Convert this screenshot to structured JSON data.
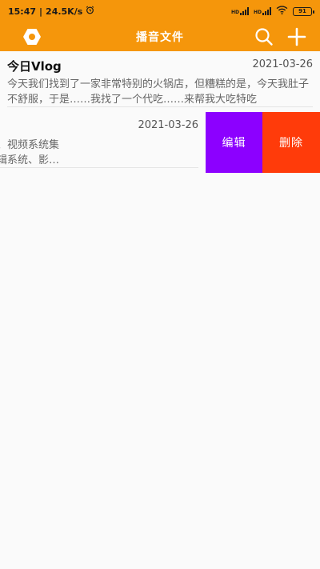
{
  "status_bar": {
    "time": "15:47",
    "network_speed": "24.5K/s",
    "alarm_icon": "alarm-clock-icon",
    "hd1": "HD",
    "hd2": "HD",
    "battery": "91"
  },
  "app_bar": {
    "title": "播音文件",
    "left_icon": "settings-hex-icon",
    "search_icon": "search-icon",
    "add_icon": "plus-icon"
  },
  "files": [
    {
      "title": "今日Vlog",
      "date": "2021-03-26",
      "description": "今天我们找到了一家非常特别的火锅店，但糟糕的是，今天我肚子不舒服，于是……我找了一个代吃……来帮我大吃特吃"
    },
    {
      "title": "",
      "date": "2021-03-26",
      "description": "司是以广电设备的销售、视频系统集\n录音棚建设、非线性编辑系统、影…"
    }
  ],
  "swipe_actions": {
    "edit_label": "编辑",
    "delete_label": "删除"
  },
  "colors": {
    "accent": "#f5960b",
    "edit": "#8c00ff",
    "delete": "#ff3b0a"
  }
}
